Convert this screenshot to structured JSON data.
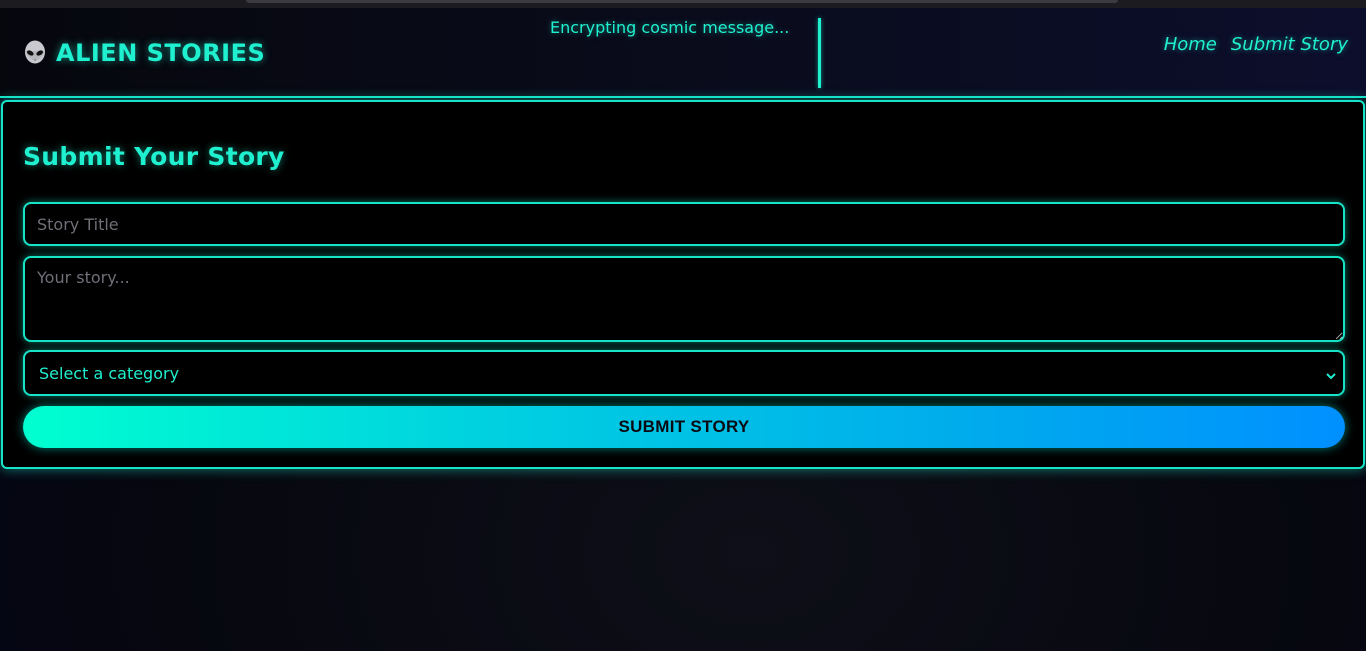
{
  "header": {
    "logo_text": "ALIEN STORIES",
    "logo_icon": "alien-icon",
    "status_text": "Encrypting cosmic message..."
  },
  "nav": {
    "items": [
      {
        "label": "Home"
      },
      {
        "label": "Submit Story"
      }
    ]
  },
  "form": {
    "heading": "Submit Your Story",
    "title_placeholder": "Story Title",
    "title_value": "",
    "story_placeholder": "Your story...",
    "story_value": "",
    "category_selected": "Select a category",
    "submit_label": "SUBMIT STORY"
  },
  "colors": {
    "accent": "#1ff0cf",
    "button_gradient_start": "#00ffd0",
    "button_gradient_end": "#0090ff",
    "background": "#000000"
  }
}
